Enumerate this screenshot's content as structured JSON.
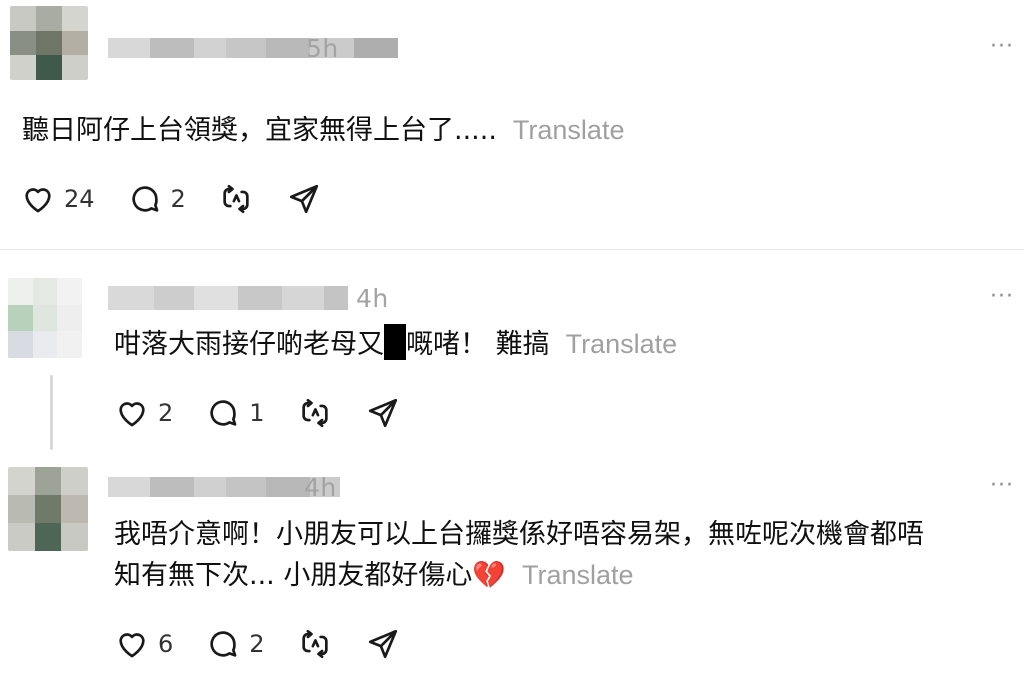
{
  "posts": [
    {
      "time": "5h",
      "text": "聽日阿仔上台領獎，宜家無得上台了.....",
      "translate": "Translate",
      "likes": "24",
      "comments": "2",
      "more": "···",
      "icons": [
        "heart-icon",
        "comment-icon",
        "repost-icon",
        "share-icon"
      ]
    },
    {
      "time": "4h",
      "text_before": "咁落大雨接仔啲老母又",
      "text_after": "嘅啫！ 難搞",
      "translate": "Translate",
      "likes": "2",
      "comments": "1",
      "more": "···"
    },
    {
      "time": "4h",
      "line1": "我唔介意啊！小朋友可以上台攞獎係好唔容易架，無咗呢次機會都唔",
      "line2": "知有無下次... 小朋友都好傷心",
      "emoji": "💔",
      "translate": "Translate",
      "likes": "6",
      "comments": "2",
      "more": "···"
    }
  ],
  "colors": {
    "text": "#101010",
    "secondary": "#a3a3a3",
    "divider": "#e6e6e6",
    "redaction": "#000000"
  }
}
